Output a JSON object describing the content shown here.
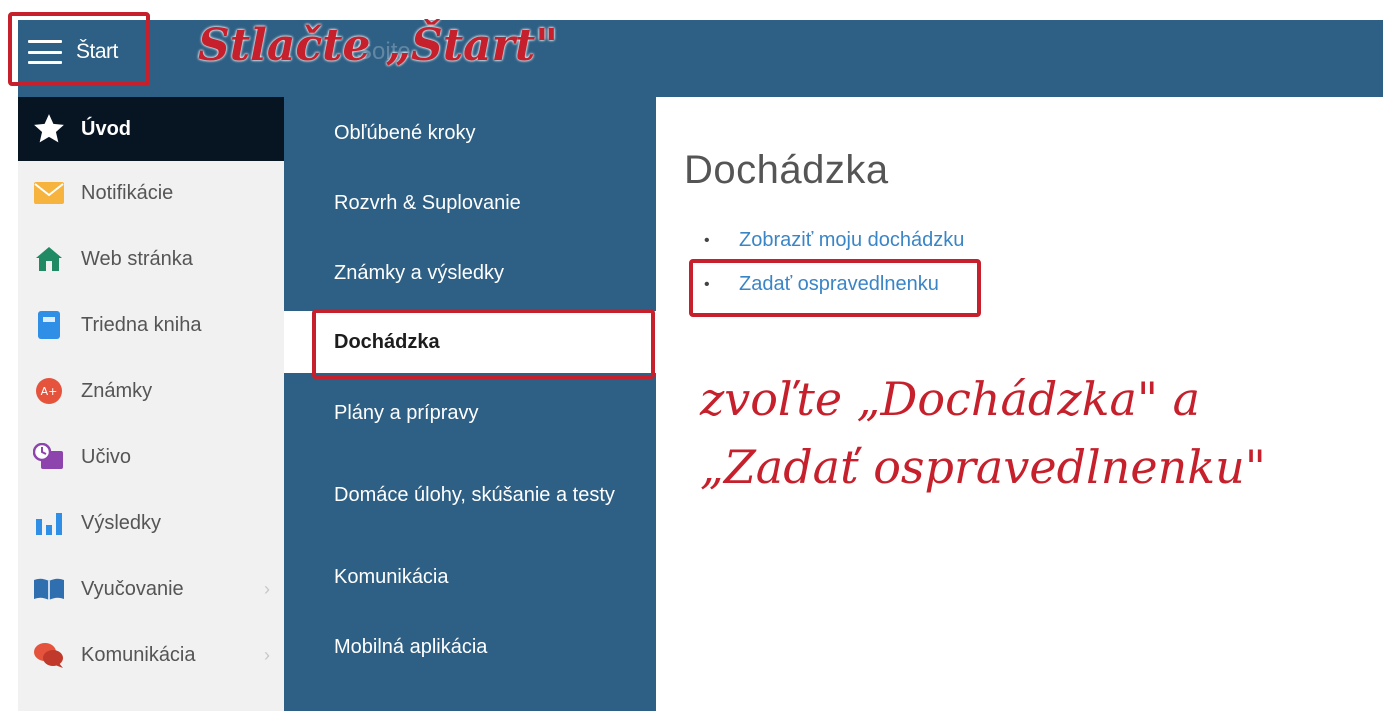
{
  "header": {
    "start_label": "Štart",
    "faded_title": "Šoite"
  },
  "sidebar": {
    "items": [
      {
        "label": "Úvod",
        "icon": "star-icon"
      },
      {
        "label": "Notifikácie",
        "icon": "envelope-icon"
      },
      {
        "label": "Web stránka",
        "icon": "home-icon"
      },
      {
        "label": "Triedna kniha",
        "icon": "book-icon"
      },
      {
        "label": "Známky",
        "icon": "grades-icon"
      },
      {
        "label": "Učivo",
        "icon": "curriculum-icon"
      },
      {
        "label": "Výsledky",
        "icon": "bar-chart-icon"
      },
      {
        "label": "Vyučovanie",
        "icon": "open-book-icon"
      },
      {
        "label": "Komunikácia",
        "icon": "chat-icon"
      }
    ]
  },
  "menu": {
    "items": [
      "Obľúbené kroky",
      "Rozvrh & Suplovanie",
      "Známky a výsledky",
      "Dochádzka",
      "Plány a prípravy",
      "Domáce úlohy, skúšanie a testy",
      "Komunikácia",
      "Mobilná aplikácia"
    ]
  },
  "content": {
    "title": "Dochádzka",
    "links": [
      "Zobraziť moju dochádzku",
      "Zadať ospravedlnenku"
    ]
  },
  "annotations": {
    "start_note": "Stlačte „Štart\"",
    "choose_line1": "zvoľte „Dochádzka\" a",
    "choose_line2": "„Zadať ospravedlnenku\""
  },
  "colors": {
    "header_bg": "#2e5f84",
    "active_sidebar_bg": "#071522",
    "link": "#3a85c6",
    "annotation_red": "#c5202b"
  }
}
